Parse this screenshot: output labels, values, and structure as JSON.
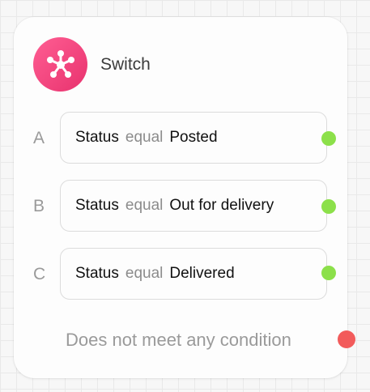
{
  "node": {
    "title": "Switch",
    "icon": "hub-network-icon",
    "icon_gradient": [
      "#ff5e93",
      "#e8326e"
    ]
  },
  "cases": [
    {
      "label": "A",
      "field": "Status",
      "operator": "equal",
      "value": "Posted"
    },
    {
      "label": "B",
      "field": "Status",
      "operator": "equal",
      "value": "Out for delivery"
    },
    {
      "label": "C",
      "field": "Status",
      "operator": "equal",
      "value": "Delivered"
    }
  ],
  "default_branch": {
    "label": "Does not meet any condition"
  },
  "colors": {
    "match_port": "#8ce04a",
    "default_port": "#f25b5b"
  }
}
